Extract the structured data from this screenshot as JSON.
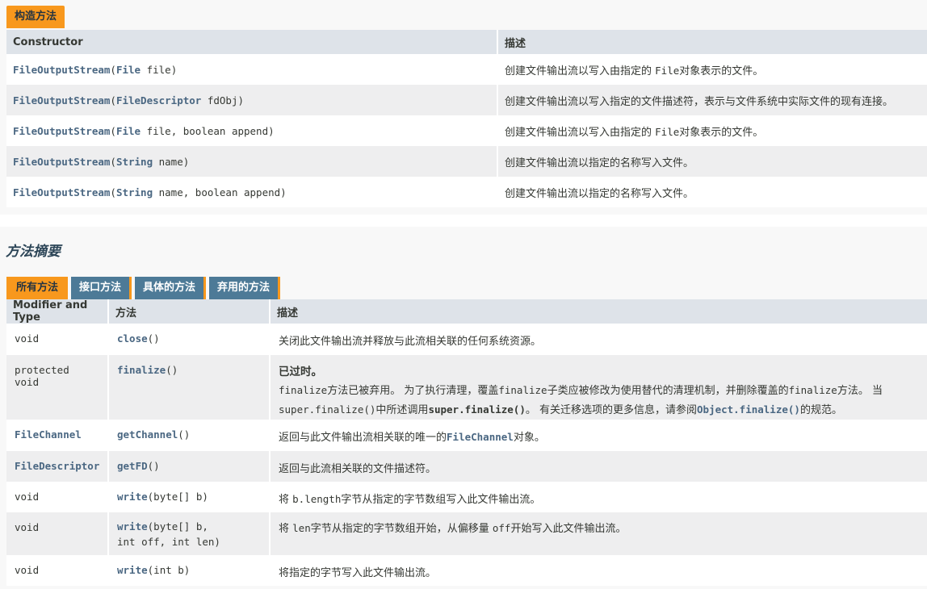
{
  "constructor_section": {
    "tab_label": "构造方法",
    "headers": [
      "Constructor",
      "描述"
    ],
    "rows": [
      {
        "name": "FileOutputStream",
        "params_type": "File",
        "params_rest": " file)",
        "desc_pre": "创建文件输出流以写入由指定的 ",
        "desc_code": "File",
        "desc_post": "对象表示的文件。"
      },
      {
        "name": "FileOutputStream",
        "params_type": "FileDescriptor",
        "params_rest": " fdObj)",
        "desc_pre": "创建文件输出流以写入指定的文件描述符，表示与文件系统中实际文件的现有连接。",
        "desc_code": "",
        "desc_post": ""
      },
      {
        "name": "FileOutputStream",
        "params_type": "File",
        "params_rest": " file, boolean append)",
        "desc_pre": "创建文件输出流以写入由指定的 ",
        "desc_code": "File",
        "desc_post": "对象表示的文件。"
      },
      {
        "name": "FileOutputStream",
        "params_type": "String",
        "params_rest": " name)",
        "desc_pre": "创建文件输出流以指定的名称写入文件。",
        "desc_code": "",
        "desc_post": ""
      },
      {
        "name": "FileOutputStream",
        "params_type": "String",
        "params_rest": " name, boolean append)",
        "desc_pre": "创建文件输出流以指定的名称写入文件。",
        "desc_code": "",
        "desc_post": ""
      }
    ]
  },
  "method_section": {
    "title": "方法摘要",
    "tabs": [
      "所有方法",
      "接口方法",
      "具体的方法",
      "弃用的方法"
    ],
    "headers": [
      "Modifier and Type",
      "方法",
      "描述"
    ],
    "rows": [
      {
        "type": "void",
        "method": "close",
        "args": "()",
        "desc": "关闭此文件输出流并释放与此流相关联的任何系统资源。"
      },
      {
        "type": "protected void",
        "method": "finalize",
        "args": "()",
        "deprecated_label": "已过时。",
        "desc_l1_code1": "finalize",
        "desc_l1_text1": "方法已被弃用。 为了执行清理，覆盖",
        "desc_l1_code2": "finalize",
        "desc_l1_text2": "子类应被修改为使用替代的清理机制，并删除覆盖的",
        "desc_l1_code3": "finalize",
        "desc_l1_text3": "方法。 当",
        "desc_l2_code1": "super.finalize()",
        "desc_l2_text1": "中所述调用",
        "desc_l2_bold": "super.finalize()",
        "desc_l2_text2": "。 有关迁移选项的更多信息，请参阅",
        "desc_l2_link": "Object.finalize()",
        "desc_l2_text3": "的规范。"
      },
      {
        "type": "FileChannel",
        "method": "getChannel",
        "args": "()",
        "desc_pre": "返回与此文件输出流相关联的唯一的",
        "desc_code": "FileChannel",
        "desc_post": "对象。"
      },
      {
        "type": "FileDescriptor",
        "method": "getFD",
        "args": "()",
        "desc": "返回与此流相关联的文件描述符。"
      },
      {
        "type": "void",
        "method": "write",
        "args": "(byte[] b)",
        "desc_pre": "将 ",
        "desc_code": "b.length",
        "desc_post": "字节从指定的字节数组写入此文件输出流。"
      },
      {
        "type": "void",
        "method": "write",
        "args_l1": "(byte[] b,",
        "args_l2": "int off, int len)",
        "desc_pre": "将 ",
        "desc_code": "len",
        "desc_mid": "字节从指定的字节数组开始，从偏移量 ",
        "desc_code2": "off",
        "desc_post": "开始写入此文件输出流。"
      },
      {
        "type": "void",
        "method": "write",
        "args": "(int b)",
        "desc": "将指定的字节写入此文件输出流。"
      }
    ]
  }
}
